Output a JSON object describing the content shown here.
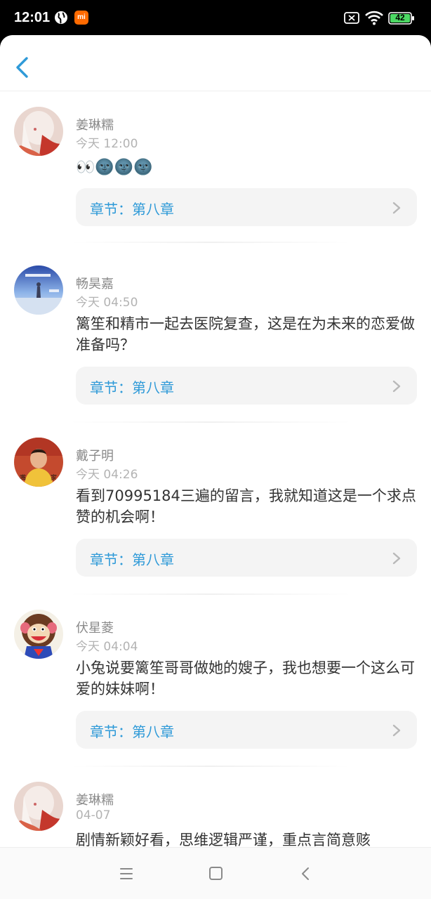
{
  "status_bar": {
    "time": "12:01",
    "mi_badge": "mi",
    "battery_level": "42"
  },
  "header": {
    "back_icon": "chevron-left-icon",
    "accent_color": "#2f9ad8"
  },
  "comments": [
    {
      "name": "姜琳糯",
      "time": "今天 12:00",
      "text": "👀🌚🌚🌚",
      "chapter": "章节：第八章"
    },
    {
      "name": "畅昊嘉",
      "time": "今天 04:50",
      "text": "篱笙和精市一起去医院复查，这是在为未来的恋爱做准备吗？",
      "chapter": "章节：第八章"
    },
    {
      "name": "戴子明",
      "time": "今天 04:26",
      "text": "看到70995184三遍的留言，我就知道这是一个求点赞的机会啊！",
      "chapter": "章节：第八章"
    },
    {
      "name": "伏星菱",
      "time": "今天 04:04",
      "text": "小兔说要篱笙哥哥做她的嫂子，我也想要一个这么可爱的妹妹啊！",
      "chapter": "章节：第八章"
    },
    {
      "name": "姜琳糯",
      "time": "04-07",
      "text": "剧情新颖好看，思维逻辑严谨，重点言简意赅"
    }
  ],
  "nav_bar": {
    "icons": [
      "menu-icon",
      "home-square-icon",
      "back-triangle-icon"
    ]
  }
}
